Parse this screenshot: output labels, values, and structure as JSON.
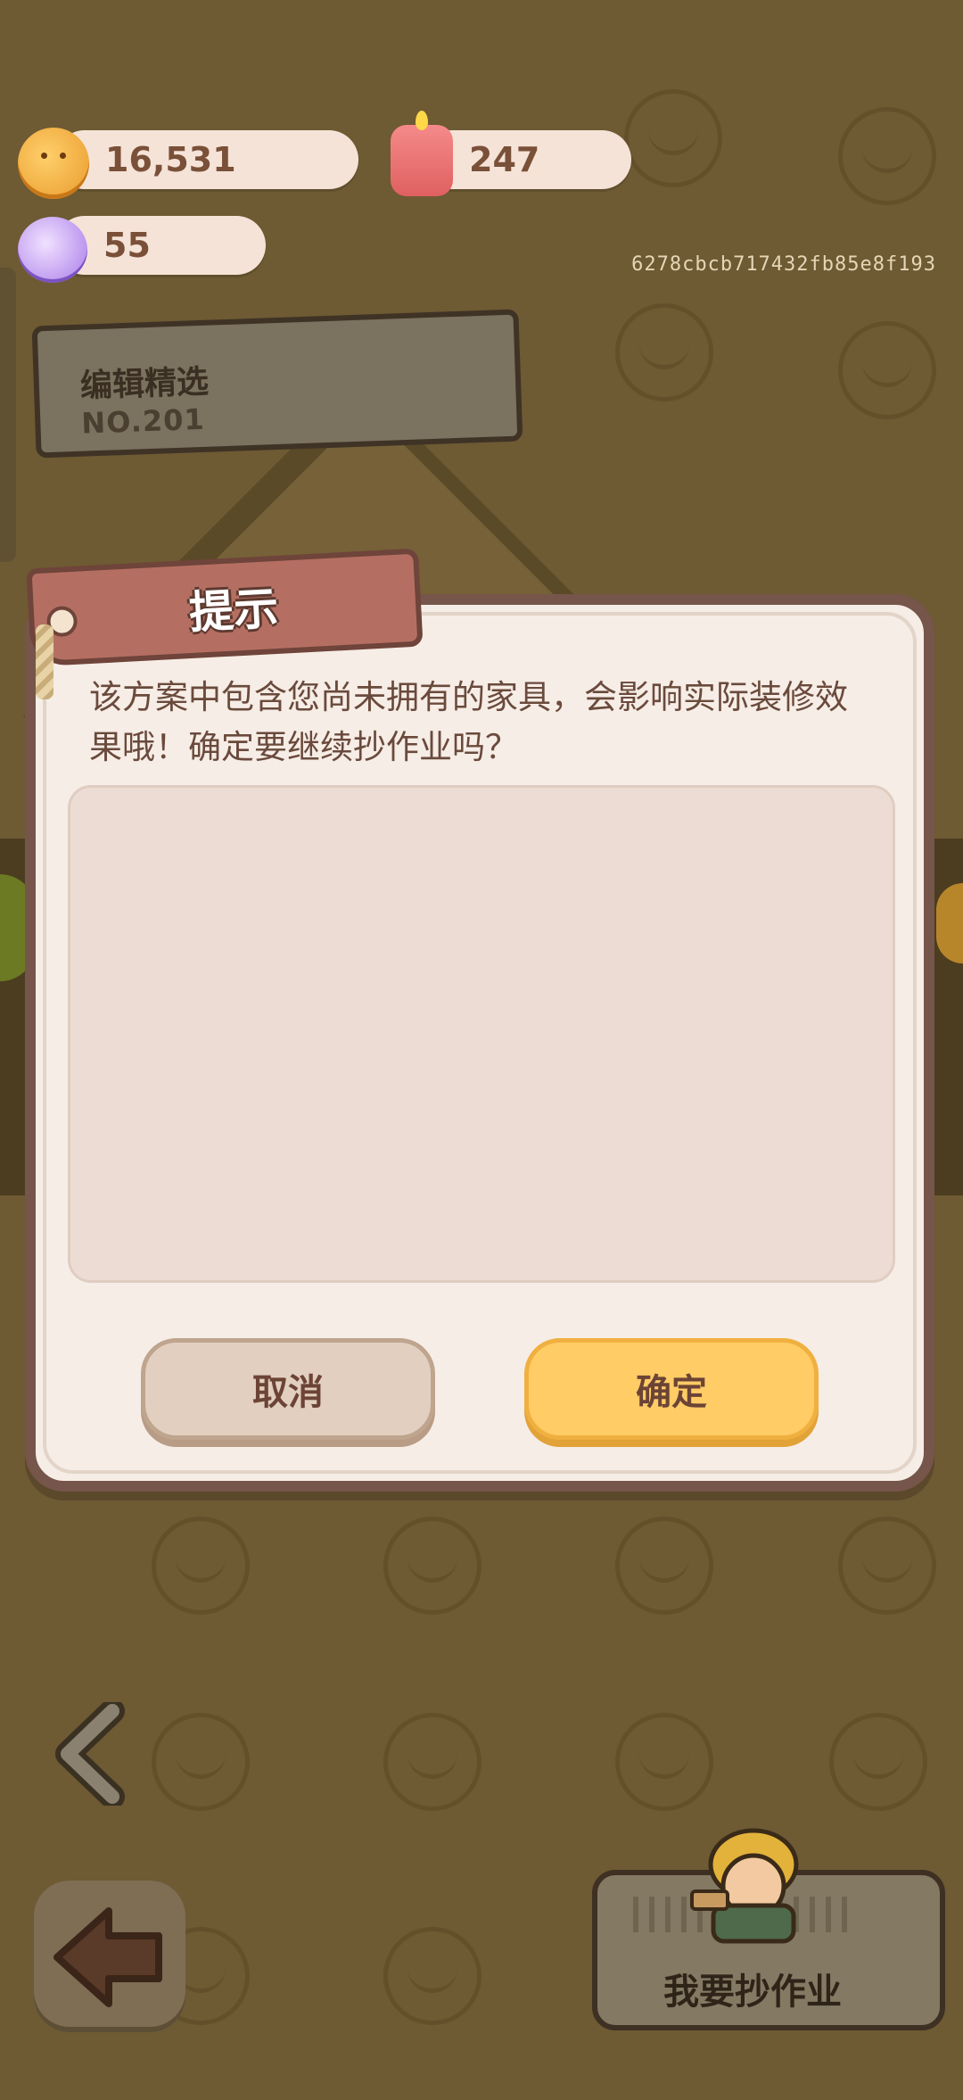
{
  "currency": {
    "coins": "16,531",
    "candles": "247",
    "gems": "55"
  },
  "device_id": "6278cbcb717432fb85e8f193",
  "editor_pick": {
    "title": "编辑精选",
    "number": "NO.201"
  },
  "dialog": {
    "title": "提示",
    "message": "该方案中包含您尚未拥有的家具，会影响实际装修效果哦！确定要继续抄作业吗？",
    "cancel_label": "取消",
    "confirm_label": "确定"
  },
  "bottom": {
    "copy_label": "我要抄作业"
  },
  "icons": [
    "coin-icon",
    "candle-icon",
    "gem-icon",
    "back-arrow-icon",
    "chevron-left-icon",
    "rope-icon"
  ],
  "colors": {
    "background": "#6e5a33",
    "dialog_bg": "#f6ede6",
    "dialog_border": "#76554a",
    "tag": "#b56f62",
    "confirm": "#ffcc66",
    "cancel": "#e2cfbf"
  }
}
